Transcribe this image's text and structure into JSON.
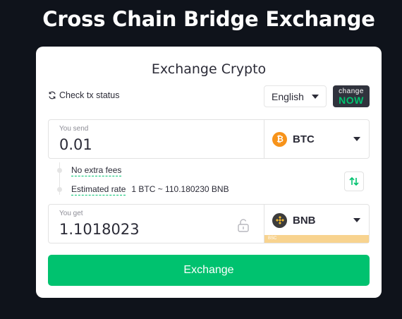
{
  "page": {
    "title": "Cross Chain Bridge Exchange"
  },
  "card": {
    "title": "Exchange Crypto",
    "tx_status": "Check tx status",
    "language": "English",
    "logo": {
      "line1": "change",
      "line2": "NOW"
    }
  },
  "send": {
    "label": "You send",
    "value": "0.01",
    "ticker": "BTC",
    "icon": "bitcoin-icon",
    "icon_color": "#f7931a"
  },
  "info": {
    "fees": "No extra fees",
    "rate_label": "Estimated rate",
    "rate_value": "1 BTC ~ 110.180230 BNB"
  },
  "get": {
    "label": "You get",
    "value": "1.1018023",
    "ticker": "BNB",
    "icon": "bnb-icon",
    "icon_color": "#f3ba2f",
    "network": "BSC"
  },
  "action": {
    "exchange": "Exchange"
  },
  "colors": {
    "accent": "#00c26f",
    "background": "#0f131b"
  }
}
